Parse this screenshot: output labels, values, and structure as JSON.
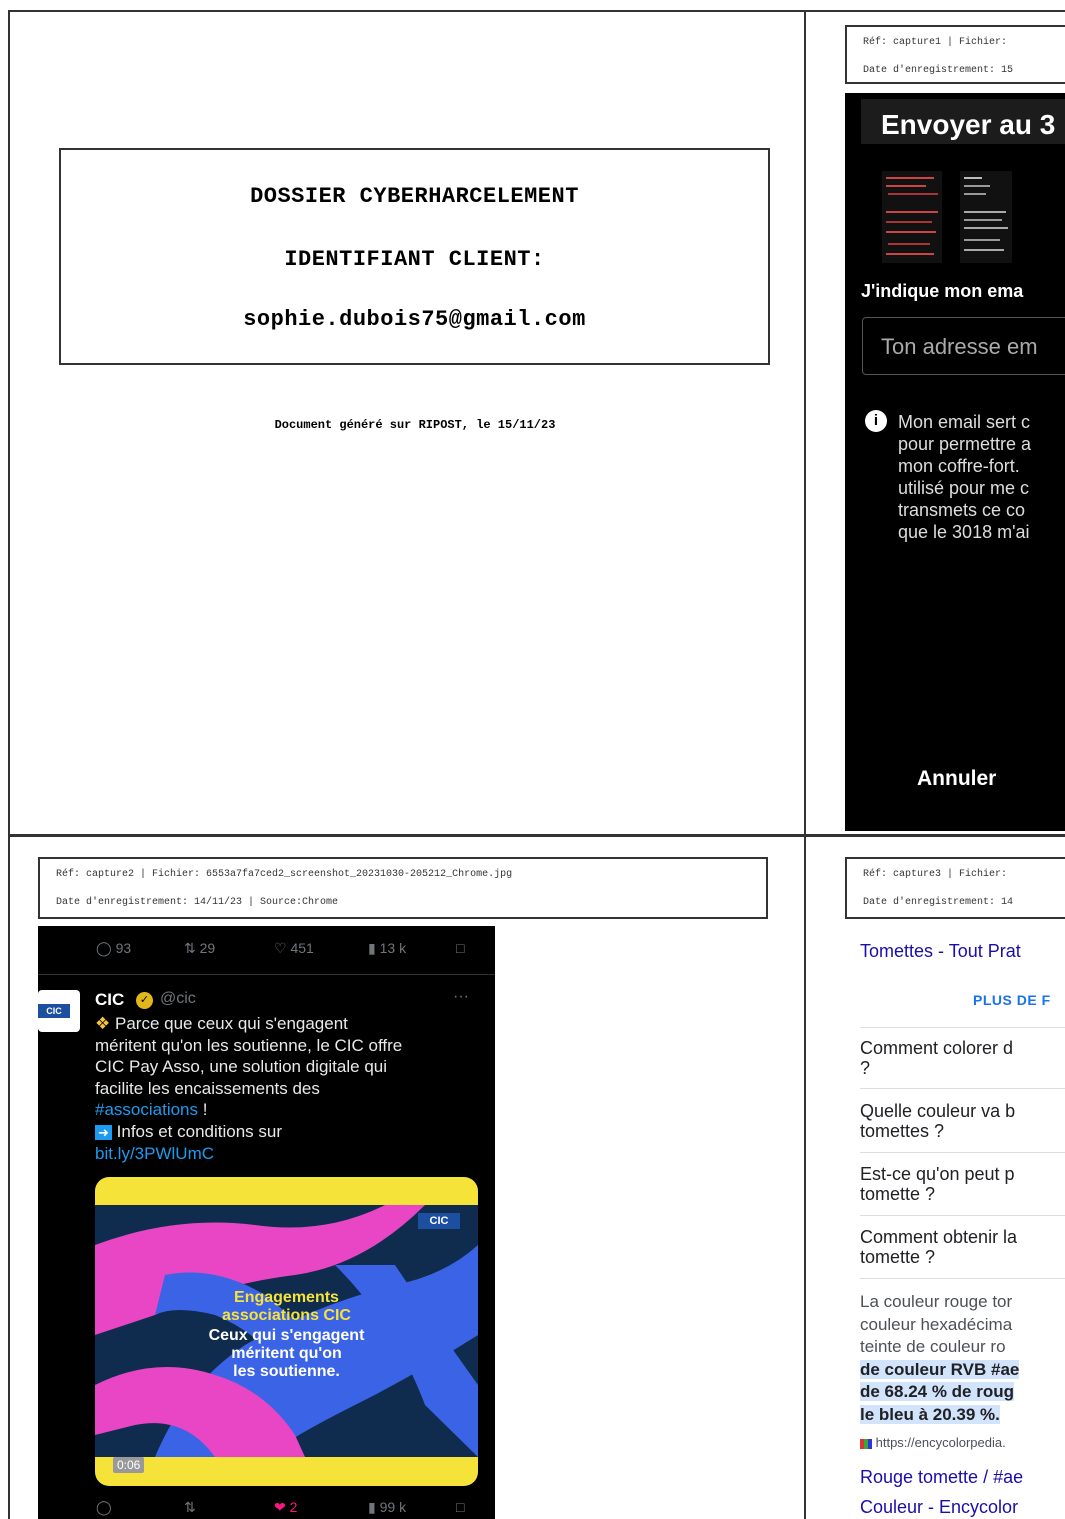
{
  "cover": {
    "title": "DOSSIER CYBERHARCELEMENT",
    "id_label": "IDENTIFIANT CLIENT:",
    "email": "sophie.dubois75@gmail.com",
    "footer": "Document généré sur RIPOST, le 15/11/23"
  },
  "capture1": {
    "meta_line1": "Réf: capture1 | Fichier:",
    "meta_line2": "Date d'enregistrement: 15",
    "title": "Envoyer au 3",
    "email_label": "J'indique mon ema",
    "input_placeholder": "Ton adresse em",
    "info_lines": [
      "Mon email sert c",
      "pour permettre a",
      "mon coffre-fort.",
      "utilisé pour me c",
      "transmets ce co",
      "que le 3018 m'ai"
    ],
    "cancel_label": "Annuler"
  },
  "capture2": {
    "meta_line1": "Réf: capture2 | Fichier: 6553a7fa7ced2_screenshot_20231030-205212_Chrome.jpg",
    "meta_line2": "Date d'enregistrement: 14/11/23 | Source:Chrome",
    "top_actions": {
      "replies": "93",
      "retweets": "29",
      "likes": "451",
      "views": "13 k"
    },
    "account_name": "CIC",
    "handle": "@cic",
    "more": "···",
    "avatar_logo": "CIC",
    "body_line1": "Parce que ceux qui s'engagent",
    "body_line2": "méritent qu'on les soutienne, le CIC offre",
    "body_line3": "CIC Pay Asso, une solution digitale qui",
    "body_line4": "facilite les encaissements des",
    "hashtag": "#associations",
    "body_tail": " !",
    "info_line": "Infos et conditions sur",
    "link": "bit.ly/3PWlUmC",
    "image": {
      "logo": "CIC",
      "line1": "Engagements",
      "line2": "associations CIC",
      "line3": "Ceux qui s'engagent",
      "line4": "méritent qu'on",
      "line5": "les soutienne.",
      "duration": "0:06"
    },
    "bottom_actions": {
      "likes": "2",
      "views": "99 k"
    }
  },
  "capture3": {
    "meta_line1": "Réf: capture3 | Fichier:",
    "meta_line2": "Date d'enregistrement: 14",
    "result_link": "Tomettes - Tout Prat",
    "more_label": "PLUS DE F",
    "questions": [
      {
        "l1": "Comment colorer d",
        "l2": "?"
      },
      {
        "l1": "Quelle couleur va b",
        "l2": "tomettes ?"
      },
      {
        "l1": "Est-ce qu'on peut p",
        "l2": "tomette ?"
      },
      {
        "l1": "Comment obtenir la",
        "l2": "tomette ?"
      }
    ],
    "para_l1": "La couleur rouge tor",
    "para_l2": "couleur hexadécima",
    "para_l3": "teinte de couleur ro",
    "para_l4": "de couleur RVB #ae",
    "para_l5": "de 68.24 % de roug",
    "para_l6": "le bleu à 20.39 %.",
    "source_url": "https://encycolorpedia.",
    "link1": "Rouge tomette / #ae",
    "link2": "Couleur - Encycolor"
  },
  "colors": {
    "link": "#1a0dab",
    "twitter_link": "#1d9bf0",
    "like": "#f91880",
    "cic_yellow": "#f5e33a"
  }
}
